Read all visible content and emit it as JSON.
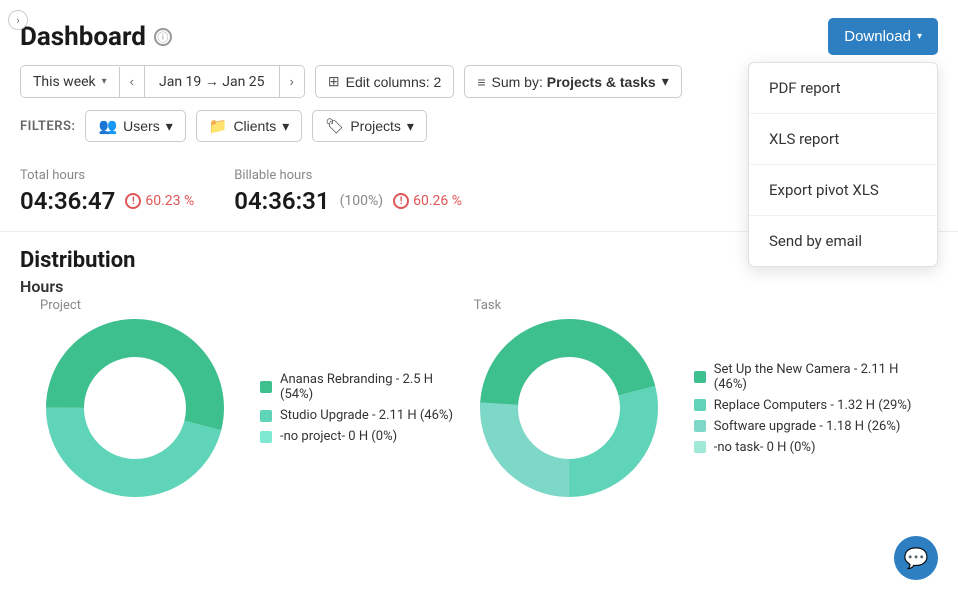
{
  "page": {
    "title": "Dashboard",
    "back_label": "›"
  },
  "header": {
    "download_label": "Download",
    "info_icon": "ℹ"
  },
  "toolbar": {
    "period_label": "This week",
    "period_range": "Jan 19 → Jan 25",
    "prev_label": "‹",
    "next_label": "›",
    "edit_columns_label": "Edit columns: 2",
    "sum_by_label": "Sum by: Projects & tasks"
  },
  "filters": {
    "label": "FILTERS:",
    "users_label": "Users",
    "clients_label": "Clients",
    "projects_label": "Projects"
  },
  "stats": {
    "total_hours_label": "Total hours",
    "total_hours_value": "04:36:47",
    "total_hours_pct": "60.23 %",
    "billable_hours_label": "Billable hours",
    "billable_hours_value": "04:36:31",
    "billable_hours_note": "(100%)",
    "billable_hours_pct": "60.26 %"
  },
  "distribution": {
    "title": "Distribution",
    "hours_label": "Hours",
    "project_sub_label": "Project",
    "task_sub_label": "Task"
  },
  "project_chart": {
    "segments": [
      {
        "label": "Ananas Rebranding - 2.5 H (54%)",
        "color": "#3dbf8e",
        "value": 54
      },
      {
        "label": "Studio Upgrade - 2.11 H (46%)",
        "color": "#5fd4b8",
        "value": 46
      },
      {
        "label": "-no project- 0 H (0%)",
        "color": "#7ee8d0",
        "value": 0
      }
    ]
  },
  "task_chart": {
    "segments": [
      {
        "label": "Set Up the New Camera - 2.11 H (46%)",
        "color": "#3dbf8e",
        "value": 46
      },
      {
        "label": "Replace Computers - 1.32 H (29%)",
        "color": "#5fd4b8",
        "value": 29
      },
      {
        "label": "Software upgrade - 1.18 H (26%)",
        "color": "#7ee8d0",
        "value": 26
      },
      {
        "label": "-no task- 0 H (0%)",
        "color": "#a0e8d8",
        "value": 0
      }
    ]
  },
  "dropdown": {
    "items": [
      {
        "label": "PDF report"
      },
      {
        "label": "XLS report"
      },
      {
        "label": "Export pivot XLS"
      },
      {
        "label": "Send by email"
      }
    ]
  }
}
